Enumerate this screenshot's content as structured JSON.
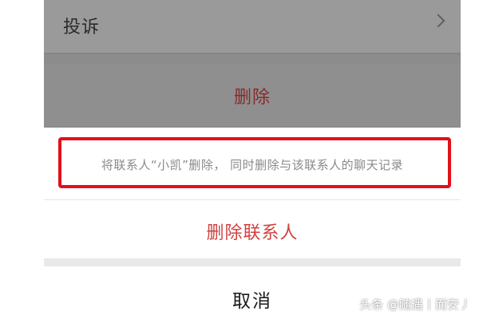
{
  "settings": {
    "complain_label": "投诉",
    "delete_label": "删除"
  },
  "action_sheet": {
    "description": "将联系人“小凯”删除， 同时删除与该联系人的聊天记录",
    "delete_contact_label": "删除联系人",
    "cancel_label": "取消"
  },
  "watermark": "头条 @随遇丨而安丿",
  "icons": {
    "chevron": "chevron-right-icon"
  },
  "colors": {
    "highlight": "#e0101a",
    "destructive": "#d04040"
  }
}
